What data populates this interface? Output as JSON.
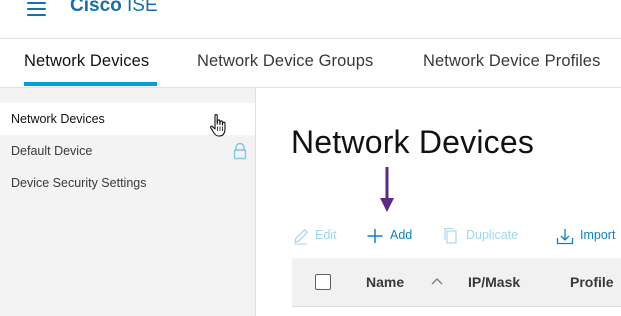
{
  "header": {
    "brand": "Cisco",
    "product": "ISE"
  },
  "tabs": [
    {
      "label": "Network Devices",
      "active": true
    },
    {
      "label": "Network Device Groups",
      "active": false
    },
    {
      "label": "Network Device Profiles",
      "active": false
    }
  ],
  "sidebar": {
    "items": [
      {
        "label": "Network Devices",
        "selected": true
      },
      {
        "label": "Default Device",
        "selected": false,
        "icon": "lock-icon"
      },
      {
        "label": "Device Security Settings",
        "selected": false
      }
    ]
  },
  "main": {
    "title": "Network Devices",
    "toolbar": {
      "edit_label": "Edit",
      "add_label": "Add",
      "duplicate_label": "Duplicate",
      "import_label": "Import"
    },
    "table": {
      "columns": [
        "Name",
        "IP/Mask",
        "Profile"
      ]
    }
  },
  "colors": {
    "accent": "#049fd9",
    "link": "#0d82bd",
    "brand_text": "#1a6fa8",
    "annotation_arrow": "#5b2a86",
    "disabled": "#9fd7ee"
  },
  "icons": {
    "menu": "hamburger-icon",
    "lock": "lock-icon",
    "cursor": "hand-cursor-icon",
    "edit": "pencil-icon",
    "add": "plus-icon",
    "duplicate": "copy-icon",
    "import": "import-icon",
    "sort": "chevron-up-icon",
    "annotation": "down-arrow-icon"
  }
}
